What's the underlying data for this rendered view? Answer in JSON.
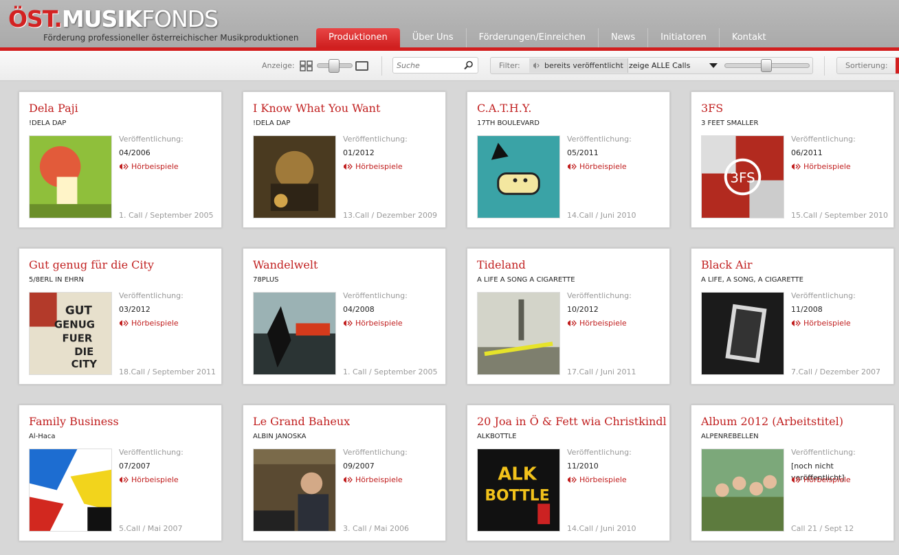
{
  "header": {
    "logo_ost": "ÖST.",
    "logo_musik": "MUSIK",
    "logo_fonds": "FONDS",
    "tagline": "Förderung professioneller österreichischer Musikproduktionen",
    "nav": [
      "Produktionen",
      "Über Uns",
      "Förderungen/Einreichen",
      "News",
      "Initiatoren",
      "Kontakt"
    ],
    "active_nav": "Produktionen"
  },
  "toolbar": {
    "anzeige_label": "Anzeige:",
    "search_placeholder": "Suche",
    "filter_label": "Filter:",
    "filter_chip": "bereits veröffentlicht",
    "filter_select": "zeige ALLE Calls",
    "sort_label": "Sortierung:"
  },
  "labels": {
    "published": "Veröffentlichung:",
    "samples": "Hörbeispiele"
  },
  "colors": {
    "accent": "#d21f1f",
    "title": "#c12020"
  },
  "cards": [
    {
      "title": "Dela Paji",
      "artist": "!DELA DAP",
      "date": "04/2006",
      "call": "1. Call / September 2005"
    },
    {
      "title": "I Know What You Want",
      "artist": "!DELA DAP",
      "date": "01/2012",
      "call": "13.Call / Dezember 2009"
    },
    {
      "title": "C.A.T.H.Y.",
      "artist": "17TH BOULEVARD",
      "date": "05/2011",
      "call": "14.Call / Juni 2010"
    },
    {
      "title": "3FS",
      "artist": "3 FEET SMALLER",
      "date": "06/2011",
      "call": "15.Call / September 2010"
    },
    {
      "title": "Gut genug für die City",
      "artist": "5/8ERL IN EHRN",
      "date": "03/2012",
      "call": "18.Call / September 2011"
    },
    {
      "title": "Wandelwelt",
      "artist": "78PLUS",
      "date": "04/2008",
      "call": "1. Call / September 2005"
    },
    {
      "title": "Tideland",
      "artist": "A LIFE A SONG A CIGARETTE",
      "date": "10/2012",
      "call": "17.Call / Juni 2011"
    },
    {
      "title": "Black Air",
      "artist": "A LIFE, A SONG, A CIGARETTE",
      "date": "11/2008",
      "call": "7.Call / Dezember 2007"
    },
    {
      "title": "Family Business",
      "artist": "Al-Haca",
      "date": "07/2007",
      "call": "5.Call / Mai 2007"
    },
    {
      "title": "Le Grand Baheux",
      "artist": "ALBIN JANOSKA",
      "date": "09/2007",
      "call": "3. Call / Mai 2006"
    },
    {
      "title": "20 Joa in Ö & Fett wia Christkindl",
      "artist": "ALKBOTTLE",
      "date": "11/2010",
      "call": "14.Call / Juni 2010"
    },
    {
      "title": "Album 2012 (Arbeitstitel)",
      "artist": "ALPENREBELLEN",
      "date": "[noch nicht\nveröffentlicht]",
      "call": "Call 21 / Sept 12"
    }
  ]
}
